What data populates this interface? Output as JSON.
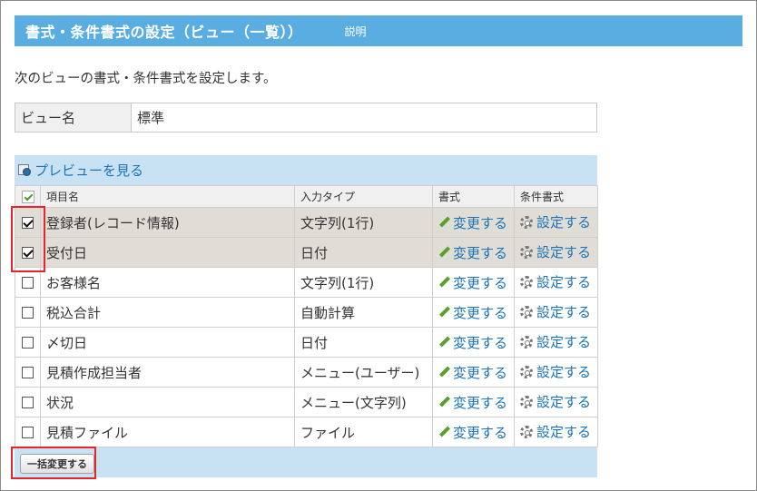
{
  "header": {
    "title": "書式・条件書式の設定（ビュー（一覧））",
    "help_link": "説明"
  },
  "intro": "次のビューの書式・条件書式を設定します。",
  "view_name": {
    "label": "ビュー名",
    "value": "標準"
  },
  "preview_link": "プレビューを見る",
  "table": {
    "columns": [
      "項目名",
      "入力タイプ",
      "書式",
      "条件書式"
    ],
    "rows": [
      {
        "name": "登録者(レコード情報)",
        "type": "文字列(1行)",
        "format": "変更する",
        "conditional": "設定する",
        "checked": true
      },
      {
        "name": "受付日",
        "type": "日付",
        "format": "変更する",
        "conditional": "設定する",
        "checked": true
      },
      {
        "name": "お客様名",
        "type": "文字列(1行)",
        "format": "変更する",
        "conditional": "設定する",
        "checked": false
      },
      {
        "name": "税込合計",
        "type": "自動計算",
        "format": "変更する",
        "conditional": "設定する",
        "checked": false
      },
      {
        "name": "〆切日",
        "type": "日付",
        "format": "変更する",
        "conditional": "設定する",
        "checked": false
      },
      {
        "name": "見積作成担当者",
        "type": "メニュー(ユーザー)",
        "format": "変更する",
        "conditional": "設定する",
        "checked": false
      },
      {
        "name": "状況",
        "type": "メニュー(文字列)",
        "format": "変更する",
        "conditional": "設定する",
        "checked": false
      },
      {
        "name": "見積ファイル",
        "type": "ファイル",
        "format": "変更する",
        "conditional": "設定する",
        "checked": false
      }
    ]
  },
  "bulk_button": "一括変更する",
  "icons": {
    "preview": "preview-magnifier-icon",
    "format": "pencil-icon",
    "conditional": "gear-icon"
  },
  "colors": {
    "header_bg": "#5aade0",
    "panel_bg": "#c8e2f3",
    "link": "#1a73b8",
    "selected_row": "#e0ddd6",
    "highlight": "#e8232a"
  }
}
